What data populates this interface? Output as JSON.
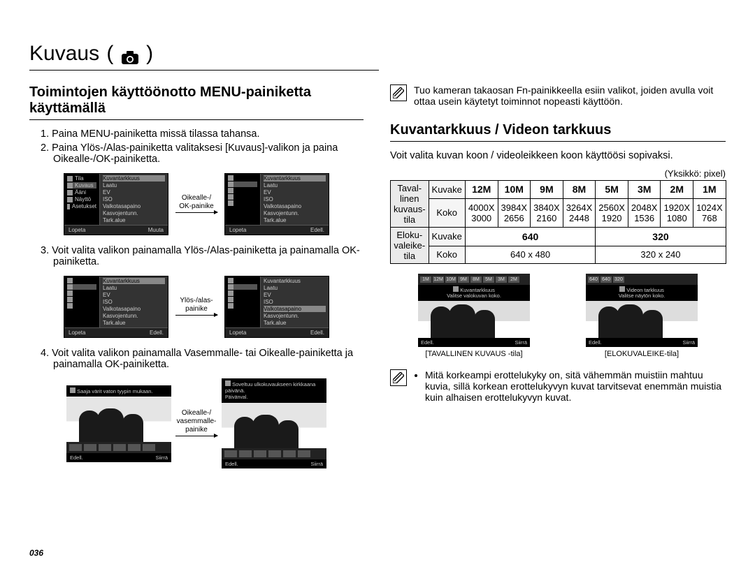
{
  "page_title": {
    "text": "Kuvaus",
    "icon": "camera-icon"
  },
  "left": {
    "section_title": "Toimintojen käyttöönotto MENU-painiketta käyttämällä",
    "steps": [
      "1. Paina MENU-painiketta missä tilassa tahansa.",
      "2. Paina Ylös-/Alas-painiketta valitaksesi [Kuvaus]-valikon ja paina Oikealle-/OK-painiketta.",
      "3. Voit valita valikon painamalla Ylös-/Alas-painiketta ja painamalla OK-painiketta.",
      "4. Voit valita valikon painamalla Vasemmalle- tai Oikealle-painiketta ja painamalla OK-painiketta."
    ],
    "arrow_labels": {
      "right_ok": "Oikealle-/\nOK-painike",
      "updown": "Ylös-/alas-\npainike",
      "lr": "Oikealle-/\nvasemmalle-\npainike"
    },
    "menu": {
      "side_items": [
        "Tila",
        "Kuvaus",
        "Ääni",
        "Näyttö",
        "Asetukset"
      ],
      "main_items": [
        "Kuvantarkkuus",
        "Laatu",
        "EV",
        "ISO",
        "Valkotasapaino",
        "Kasvojentunn.",
        "Tark.alue"
      ],
      "footer": {
        "left": "Lopeta",
        "right_change": "Muuta",
        "right_back": "Edell."
      }
    },
    "photo_captions": {
      "a": "Saaja värit vaton tyypin mukaan.",
      "b": "Soveltuu ulkokuvaukseen kirkkaana päivänä.",
      "sub": "Päivänval."
    },
    "photo_footer": {
      "left": "Edell.",
      "right": "Siirrä"
    }
  },
  "right": {
    "fn_note": "Tuo kameran takaosan Fn-painikkeella esiin valikot, joiden avulla voit ottaa usein käytetyt toiminnot nopeasti käyttöön.",
    "section_title": "Kuvantarkkuus / Videon tarkkuus",
    "intro": "Voit valita kuvan koon / videoleikkeen koon käyttöösi sopivaksi.",
    "unit": "(Yksikkö: pixel)",
    "table": {
      "row1_label": "Taval-\nlinen\nkuvaus-\ntila",
      "row2_label": "Eloku-\nvaleike-\ntila",
      "sub_kuvake": "Kuvake",
      "sub_koko": "Koko",
      "icons": [
        "12M",
        "10M",
        "9M",
        "8M",
        "5M",
        "3M",
        "2M",
        "1M"
      ],
      "sizes": [
        "4000X\n3000",
        "3984X\n2656",
        "3840X\n2160",
        "3264X\n2448",
        "2560X\n1920",
        "2048X\n1536",
        "1920X\n1080",
        "1024X\n768"
      ],
      "video_icons": [
        "640",
        "320"
      ],
      "video_sizes": [
        "640 x 480",
        "320 x 240"
      ]
    },
    "mode_a": {
      "label": "[TAVALLINEN KUVAUS -tila]",
      "line1": "Kuvantarkkuus",
      "line2": "Valitse valokuvan koko.",
      "chips": [
        "1M",
        "12M",
        "10M",
        "9M",
        "8M",
        "5M",
        "3M",
        "2M"
      ]
    },
    "mode_b": {
      "label": "[ELOKUVALEIKE-tila]",
      "line1": "Videon tarkkuus",
      "line2": "Valitse näytön koko.",
      "chips": [
        "640",
        "640",
        "320"
      ]
    },
    "mode_footer": {
      "left": "Edell.",
      "right": "Siirrä"
    },
    "res_note": "Mitä korkeampi erottelukyky on, sitä vähemmän muistiin mahtuu kuvia, sillä korkean erottelukyvyn kuvat tarvitsevat enemmän muistia kuin alhaisen erottelukyvyn kuvat."
  },
  "page_number": "036"
}
